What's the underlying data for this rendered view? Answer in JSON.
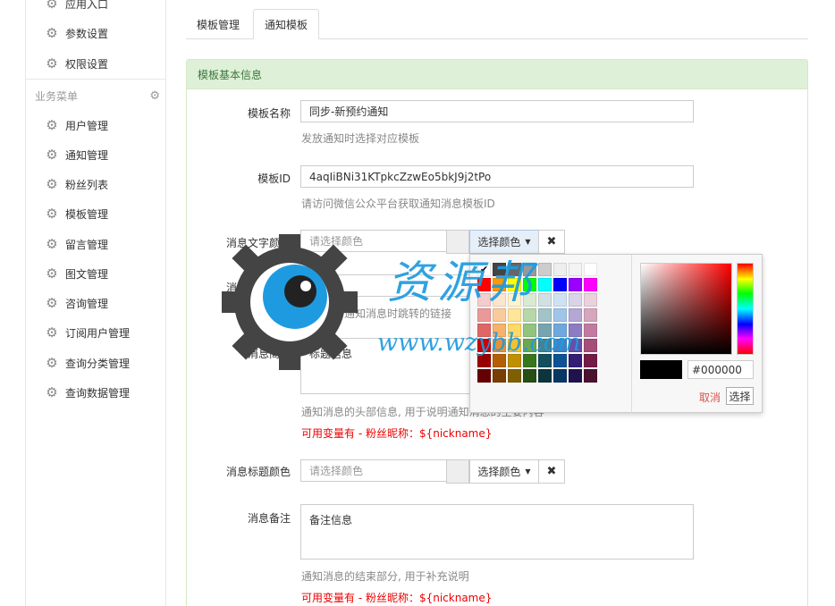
{
  "sidebar": {
    "top_items": [
      {
        "label": "应用入口",
        "icon": "gear-icon"
      },
      {
        "label": "参数设置",
        "icon": "gear-icon"
      },
      {
        "label": "权限设置",
        "icon": "gear-icon"
      }
    ],
    "section_title": "业务菜单",
    "items": [
      {
        "label": "用户管理"
      },
      {
        "label": "通知管理"
      },
      {
        "label": "粉丝列表"
      },
      {
        "label": "模板管理"
      },
      {
        "label": "留言管理"
      },
      {
        "label": "图文管理"
      },
      {
        "label": "咨询管理"
      },
      {
        "label": "订阅用户管理"
      },
      {
        "label": "查询分类管理"
      },
      {
        "label": "查询数据管理"
      }
    ]
  },
  "tabs": [
    {
      "label": "模板管理",
      "active": false
    },
    {
      "label": "通知模板",
      "active": true
    }
  ],
  "panel": {
    "title": "模板基本信息"
  },
  "form": {
    "name": {
      "label": "模板名称",
      "value": "同步-新预约通知",
      "help": "发放通知时选择对应模板"
    },
    "tpl_id": {
      "label": "模板ID",
      "value": "4aqIiBNi31KTpkcZzwEo5bkJ9j2tPo",
      "help": "请访问微信公众平台获取通知消息模板ID"
    },
    "text_color": {
      "label": "消息文字颜色",
      "placeholder": "请选择颜色",
      "button": "选择颜色"
    },
    "link": {
      "label": "消息链接地址",
      "help": "点击整个通知消息时跳转的链接"
    },
    "header": {
      "label": "消息简要",
      "value": "标题信息",
      "help": "通知消息的头部信息, 用于说明通知消息的主要内容",
      "vars": "可用变量有 - 粉丝昵称：${nickname}"
    },
    "title_color": {
      "label": "消息标题颜色",
      "placeholder": "请选择颜色",
      "button": "选择颜色"
    },
    "remark": {
      "label": "消息备注",
      "value": "备注信息",
      "help": "通知消息的结束部分, 用于补充说明",
      "vars": "可用变量有 - 粉丝昵称：${nickname}"
    }
  },
  "picker": {
    "hex": "#000000",
    "cancel": "取消",
    "choose": "选择",
    "swatches": [
      [
        "#000000",
        "#444444",
        "#666666",
        "#999999",
        "#cccccc",
        "#eeeeee",
        "#f3f3f3",
        "#ffffff"
      ],
      [
        "#ff0000",
        "#ff9900",
        "#ffff00",
        "#00ff00",
        "#00ffff",
        "#0000ff",
        "#9900ff",
        "#ff00ff"
      ],
      [
        "#f4cccc",
        "#fce5cd",
        "#fff2cc",
        "#d9ead3",
        "#d0e0e3",
        "#cfe2f3",
        "#d9d2e9",
        "#ead1dc"
      ],
      [
        "#ea9999",
        "#f9cb9c",
        "#ffe599",
        "#b6d7a8",
        "#a2c4c9",
        "#9fc5e8",
        "#b4a7d6",
        "#d5a6bd"
      ],
      [
        "#e06666",
        "#f6b26b",
        "#ffd966",
        "#93c47d",
        "#76a5af",
        "#6fa8dc",
        "#8e7cc3",
        "#c27ba0"
      ],
      [
        "#cc0000",
        "#e69138",
        "#f1c232",
        "#6aa84f",
        "#45818e",
        "#3d85c6",
        "#674ea7",
        "#a64d79"
      ],
      [
        "#990000",
        "#b45f06",
        "#bf9000",
        "#38761d",
        "#134f5c",
        "#0b5394",
        "#351c75",
        "#741b47"
      ],
      [
        "#660000",
        "#783f04",
        "#7f6000",
        "#274e13",
        "#0c343d",
        "#073763",
        "#20124d",
        "#4c1130"
      ]
    ]
  },
  "watermark": {
    "title": "资源邦",
    "url": "www.wzybb.com",
    "color": "#1e9be0"
  }
}
